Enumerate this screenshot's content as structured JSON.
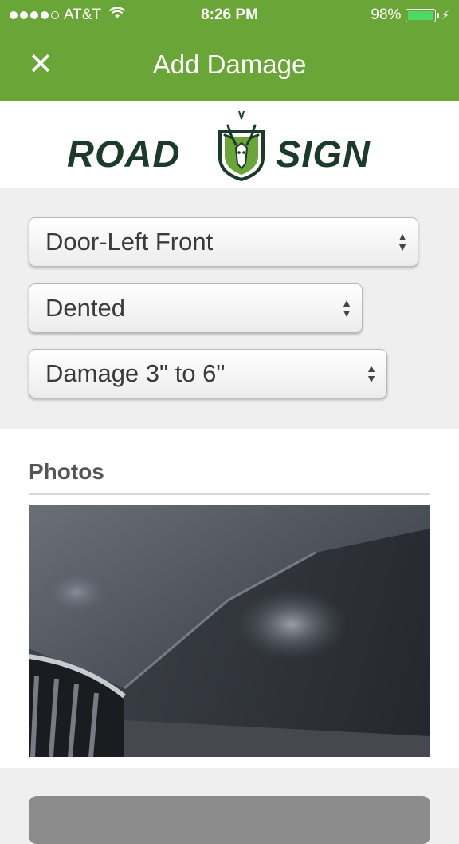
{
  "status_bar": {
    "carrier": "AT&T",
    "time": "8:26 PM",
    "battery_percent": "98%",
    "battery_level": 0.98,
    "signal_dots_filled": 4
  },
  "nav": {
    "title": "Add Damage",
    "close_icon": "close-icon"
  },
  "logo": {
    "left_text": "ROAD",
    "right_text": "SIGN",
    "emblem_icon": "deer-shield-icon"
  },
  "form": {
    "location_select": "Door-Left Front",
    "damage_type_select": "Dented",
    "damage_size_select": "Damage 3\" to 6\""
  },
  "photos": {
    "label": "Photos"
  },
  "colors": {
    "header_green": "#6aa537",
    "logo_dark_green": "#1b3a2a"
  }
}
